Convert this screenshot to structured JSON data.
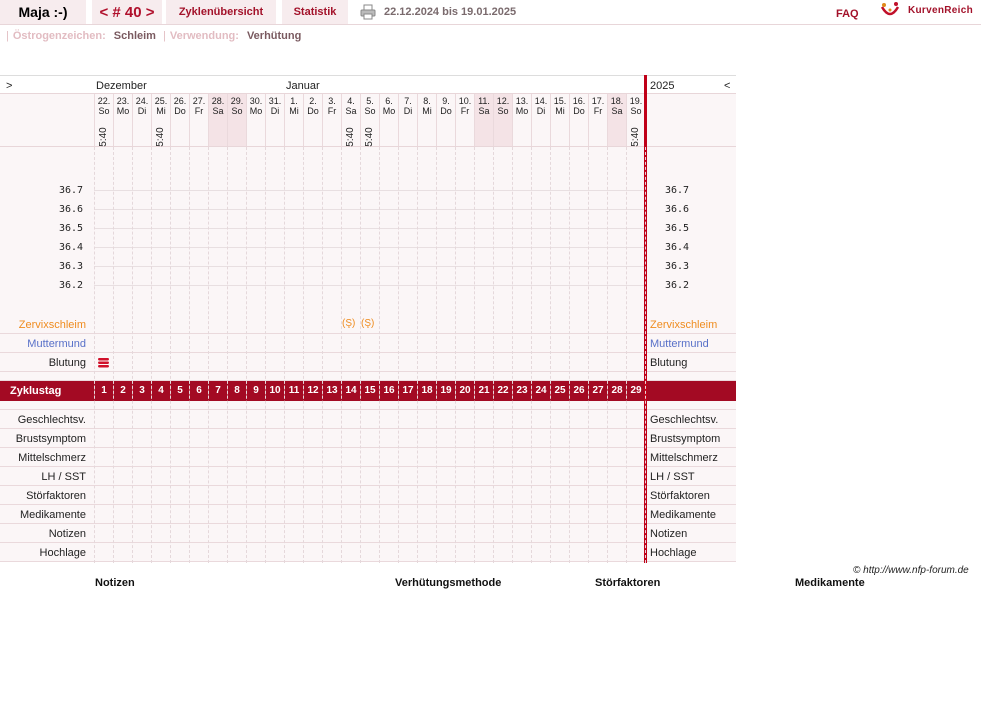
{
  "topbar": {
    "user": "Maja :-)",
    "cycle": "< # 40 >",
    "overview": "Zyklenübersicht",
    "stats": "Statistik",
    "date_range": "22.12.2024 bis 19.01.2025",
    "faq": "FAQ",
    "brand": "KurvenReich"
  },
  "info": {
    "estrogen_label": "Östrogenzeichen:",
    "estrogen_value": "Schleim",
    "usage_label": "Verwendung:",
    "usage_value": "Verhütung"
  },
  "chart": {
    "left_arrow": ">",
    "right_arrow": "<",
    "month1": "Dezember",
    "month2": "Januar",
    "year": "2025",
    "days": [
      {
        "d": "22.",
        "w": "So",
        "t": "5:40",
        "wk": false
      },
      {
        "d": "23.",
        "w": "Mo",
        "t": "",
        "wk": false
      },
      {
        "d": "24.",
        "w": "Di",
        "t": "",
        "wk": false
      },
      {
        "d": "25.",
        "w": "Mi",
        "t": "5:40",
        "wk": false
      },
      {
        "d": "26.",
        "w": "Do",
        "t": "",
        "wk": false
      },
      {
        "d": "27.",
        "w": "Fr",
        "t": "",
        "wk": false
      },
      {
        "d": "28.",
        "w": "Sa",
        "t": "",
        "wk": true
      },
      {
        "d": "29.",
        "w": "So",
        "t": "",
        "wk": true
      },
      {
        "d": "30.",
        "w": "Mo",
        "t": "",
        "wk": false
      },
      {
        "d": "31.",
        "w": "Di",
        "t": "",
        "wk": false
      },
      {
        "d": "1.",
        "w": "Mi",
        "t": "",
        "wk": false
      },
      {
        "d": "2.",
        "w": "Do",
        "t": "",
        "wk": false
      },
      {
        "d": "3.",
        "w": "Fr",
        "t": "",
        "wk": false
      },
      {
        "d": "4.",
        "w": "Sa",
        "t": "5:40",
        "wk": false
      },
      {
        "d": "5.",
        "w": "So",
        "t": "5:40",
        "wk": false
      },
      {
        "d": "6.",
        "w": "Mo",
        "t": "",
        "wk": false
      },
      {
        "d": "7.",
        "w": "Di",
        "t": "",
        "wk": false
      },
      {
        "d": "8.",
        "w": "Mi",
        "t": "",
        "wk": false
      },
      {
        "d": "9.",
        "w": "Do",
        "t": "",
        "wk": false
      },
      {
        "d": "10.",
        "w": "Fr",
        "t": "",
        "wk": false
      },
      {
        "d": "11.",
        "w": "Sa",
        "t": "",
        "wk": true
      },
      {
        "d": "12.",
        "w": "So",
        "t": "",
        "wk": true
      },
      {
        "d": "13.",
        "w": "Mo",
        "t": "",
        "wk": false
      },
      {
        "d": "14.",
        "w": "Di",
        "t": "",
        "wk": false
      },
      {
        "d": "15.",
        "w": "Mi",
        "t": "",
        "wk": false
      },
      {
        "d": "16.",
        "w": "Do",
        "t": "",
        "wk": false
      },
      {
        "d": "17.",
        "w": "Fr",
        "t": "",
        "wk": false
      },
      {
        "d": "18.",
        "w": "Sa",
        "t": "",
        "wk": true
      },
      {
        "d": "19.",
        "w": "So",
        "t": "5:40",
        "wk": false
      }
    ],
    "temps": [
      "36.7",
      "36.6",
      "36.5",
      "36.4",
      "36.3",
      "36.2"
    ],
    "mucus_mark": "(Ş)",
    "mucus_days": [
      14,
      15
    ],
    "bleeding_days": [
      1
    ]
  },
  "rows": {
    "zervix": "Zervixschleim",
    "muttermund": "Muttermund",
    "blutung": "Blutung",
    "zyklustag": "Zyklustag",
    "lower": [
      "Geschlechtsv.",
      "Brustsymptom",
      "Mittelschmerz",
      "LH / SST",
      "Störfaktoren",
      "Medikamente",
      "Notizen",
      "Hochlage"
    ]
  },
  "footer": {
    "copyright": "© http://www.nfp-forum.de",
    "notes": "Notizen",
    "method": "Verhütungsmethode",
    "factors": "Störfaktoren",
    "meds": "Medikamente"
  }
}
